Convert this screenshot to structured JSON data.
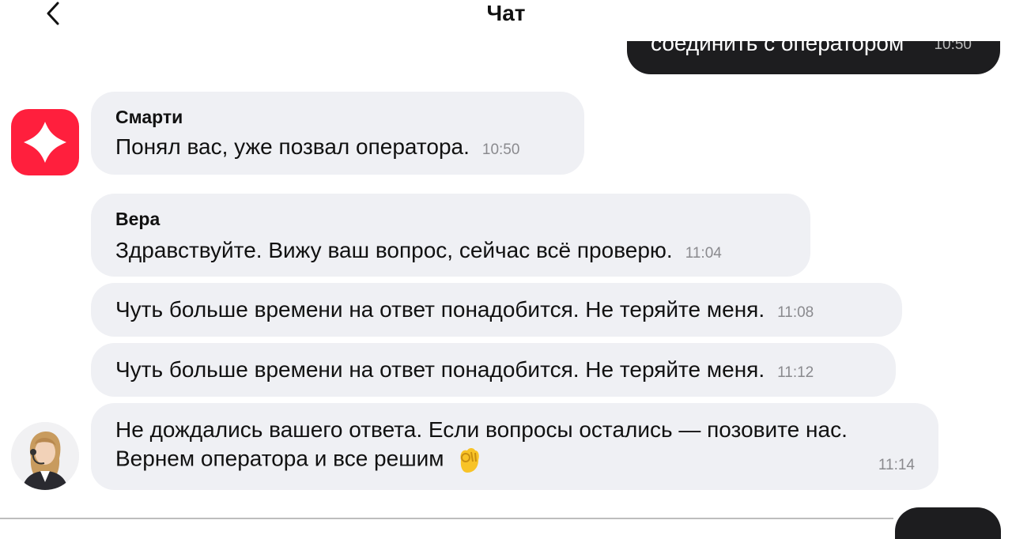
{
  "header": {
    "title": "Чат",
    "back_icon": "chevron-left-icon"
  },
  "partial_outgoing": {
    "text": "соединить с оператором",
    "time": "10:50"
  },
  "messages": [
    {
      "sender": "Смарти",
      "text": "Понял вас, уже позвал оператора.",
      "time": "10:50"
    },
    {
      "sender": "Вера",
      "text": "Здравствуйте. Вижу ваш вопрос, сейчас всё проверю.",
      "time": "11:04"
    },
    {
      "text": "Чуть больше времени на ответ понадобится. Не теряйте меня.",
      "time": "11:08"
    },
    {
      "text": "Чуть больше времени на ответ понадобится. Не теряйте меня.",
      "time": "11:12"
    },
    {
      "line1": "Не дождались вашего ответа. Если вопросы остались — позовите нас.",
      "line2": "Вернем оператора и все решим",
      "emoji": "ok-hand-icon",
      "time": "11:14"
    }
  ],
  "colors": {
    "brand": "#ff1f3d",
    "incoming_bubble": "#eff0f4",
    "outgoing_bubble": "#1d1d1f"
  }
}
